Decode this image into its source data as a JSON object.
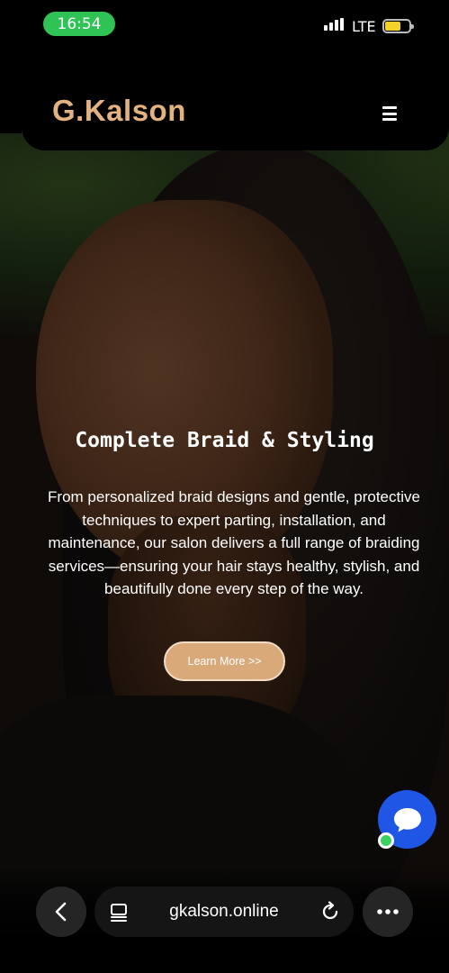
{
  "status_bar": {
    "time": "16:54",
    "network": "LTE"
  },
  "header": {
    "logo": "G.Kalson",
    "menu_icon": "hamburger-menu-icon"
  },
  "hero": {
    "title": "Complete Braid & Styling",
    "description": "From personalized braid designs and gentle, protective techniques to expert parting, installation, and maintenance, our salon delivers a full range of braiding services—ensuring your hair stays healthy, stylish, and beautifully done every step of the way.",
    "cta_label": "Learn More >>"
  },
  "chat_widget": {
    "icon": "chat-bubble-icon",
    "status": "online"
  },
  "browser": {
    "url": "gkalson.online",
    "back_icon": "chevron-left-icon",
    "tabs_icon": "tabs-icon",
    "reload_icon": "reload-icon",
    "more_icon": "more-dots-icon"
  },
  "colors": {
    "brand": "#e2b280",
    "cta": "#d9a97a",
    "status_green": "#2fc254",
    "chat_blue": "#1f56e6"
  }
}
